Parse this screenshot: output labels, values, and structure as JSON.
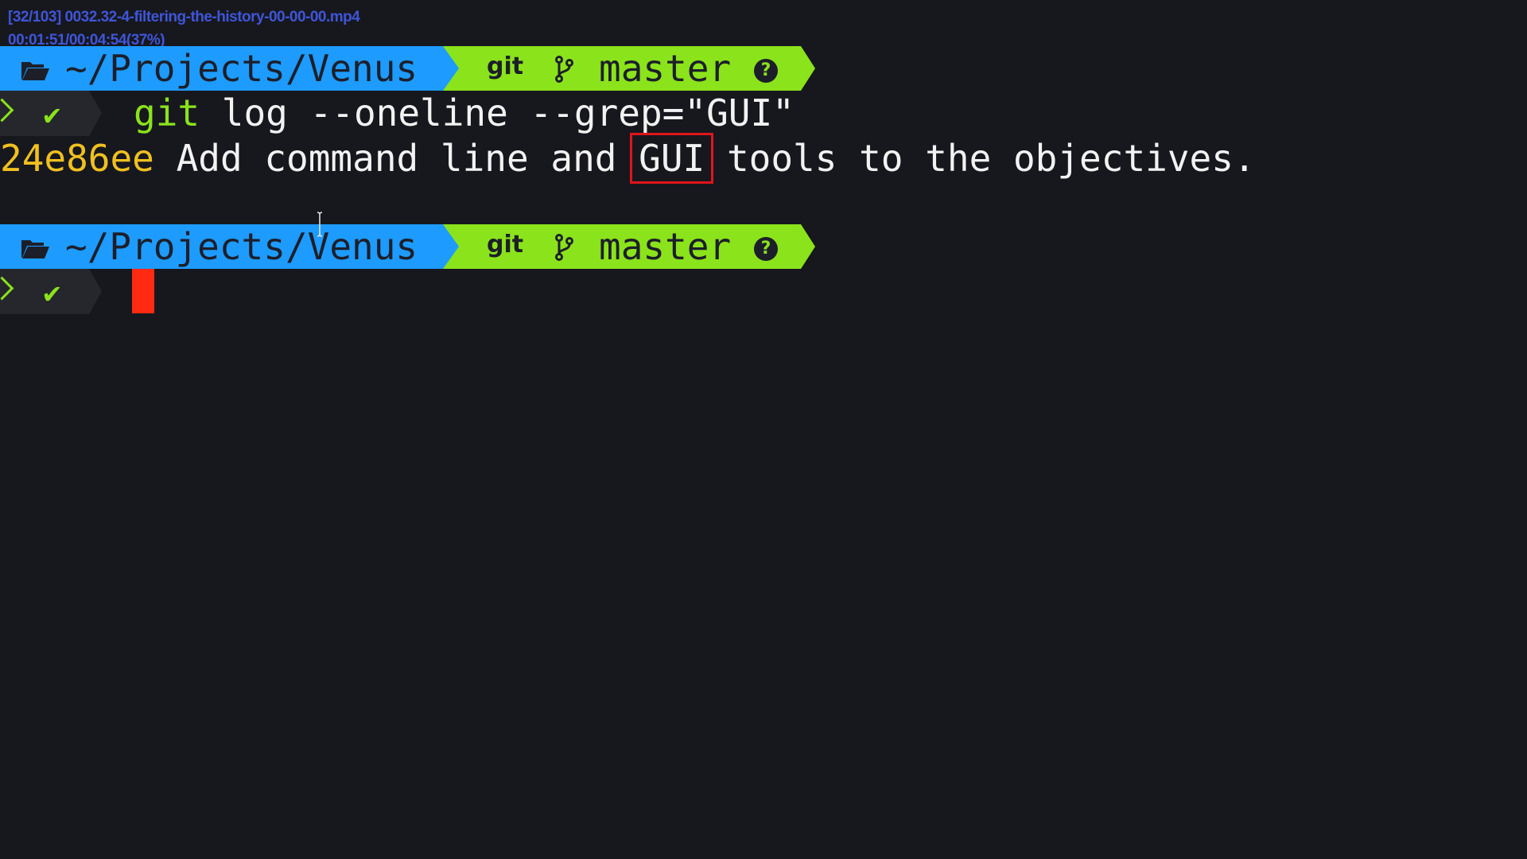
{
  "overlay": {
    "file_info": "[32/103] 0032.32-4-filtering-the-history-00-00-00.mp4",
    "time_info": "00:01:51/00:04:54(37%)"
  },
  "prompts": [
    {
      "path": "~/Projects/Venus",
      "vcs": "git",
      "branch": "master",
      "status_icon": "question-circle-icon"
    },
    {
      "path": "~/Projects/Venus",
      "vcs": "git",
      "branch": "master",
      "status_icon": "question-circle-icon"
    }
  ],
  "command": {
    "program": "git",
    "args": " log --oneline --grep=\"GUI\""
  },
  "output": {
    "hash": "24e86ee",
    "message_before": " Add command line and ",
    "highlight": "GUI",
    "message_after": " tools to the objectives."
  },
  "status_symbol": "✔",
  "question_symbol": "?",
  "colors": {
    "background": "#17181e",
    "path_segment": "#1e9bff",
    "git_segment": "#8be31b",
    "hash": "#f0c020",
    "cursor": "#ff2a12",
    "highlight_box": "#e0141b"
  }
}
